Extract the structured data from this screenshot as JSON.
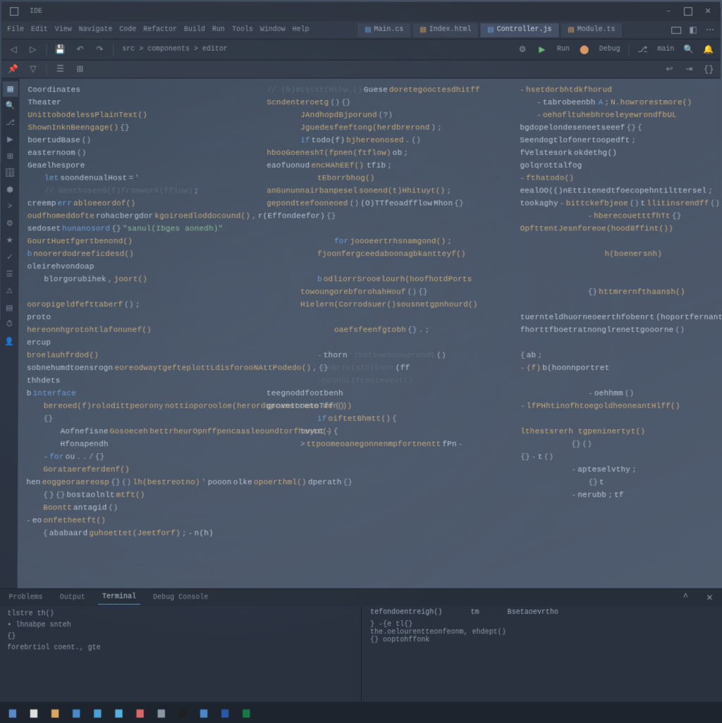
{
  "titlebar": {
    "app_label": "IDE",
    "right_label": "minimize maximize close"
  },
  "tabs": [
    {
      "label": "Main.cs",
      "active": false
    },
    {
      "label": "Index.html",
      "active": false
    },
    {
      "label": "Controller.js",
      "active": true
    },
    {
      "label": "Module.ts",
      "active": false
    }
  ],
  "menu": {
    "items": [
      "File",
      "Edit",
      "View",
      "Navigate",
      "Code",
      "Refactor",
      "Build",
      "Run",
      "Tools",
      "Window",
      "Help"
    ]
  },
  "toolbar": {
    "breadcrumb": "src > components > editor",
    "run_label": "Run",
    "debug_label": "Debug",
    "branch": "main"
  },
  "sidebar": {
    "items": [
      "explorer",
      "search",
      "git",
      "debug",
      "extensions",
      "database",
      "docker",
      "terminal",
      "settings",
      "bookmark",
      "test",
      "outline",
      "problems",
      "output",
      "timeline",
      "account"
    ]
  },
  "code": [
    {
      "i": 0,
      "t": [
        [
          "var",
          "Coordinates"
        ]
      ]
    },
    {
      "i": 0,
      "t": [
        [
          "var",
          "Theater"
        ]
      ]
    },
    {
      "i": 0,
      "t": [
        [
          "fn",
          "UnittobodelessPlainText()"
        ]
      ]
    },
    {
      "i": 0,
      "t": [
        [
          "fn",
          "ShownInknBeengage()"
        ],
        [
          "op",
          "{}"
        ]
      ]
    },
    {
      "i": 0,
      "t": [
        [
          "var",
          "boertudBase"
        ],
        [
          "op",
          "()"
        ]
      ]
    },
    {
      "i": 0,
      "t": [
        [
          "var",
          "easternoom"
        ],
        [
          "op",
          "()"
        ]
      ]
    },
    {
      "i": 0,
      "t": [
        [
          "var",
          "Geaelhespore"
        ]
      ]
    },
    {
      "i": 1,
      "t": [
        [
          "kw",
          "let"
        ],
        [
          "var",
          "soondenualHost"
        ],
        [
          "op",
          "="
        ],
        [
          "str",
          "'"
        ]
      ]
    },
    {
      "i": 1,
      "t": [
        [
          "cmt",
          "// Genthosend(f)framwork(fflow)"
        ],
        [
          "op",
          ";"
        ]
      ]
    },
    {
      "i": 0,
      "t": [
        [
          "var",
          "creemp"
        ],
        [
          "kw",
          "err"
        ],
        [
          "fn",
          "abloeeordof()"
        ]
      ]
    },
    {
      "i": 0,
      "t": [
        [
          "fn",
          "oudfhomeddofte"
        ],
        [
          "var",
          "rohacbergdor"
        ],
        [
          "fn",
          "kgoiroedloddocound()"
        ],
        [
          "op",
          ","
        ],
        [
          "var",
          "r(Effondeefor)"
        ],
        [
          "op",
          "{}"
        ]
      ]
    },
    {
      "i": 0,
      "t": [
        [
          "var",
          "sedoset"
        ],
        [
          "kw",
          "hunanosord"
        ],
        [
          "op",
          "{}"
        ],
        [
          "str",
          "\"sanul(Ibges aonedh)\""
        ]
      ]
    },
    {
      "i": 0,
      "t": [
        [
          "fn",
          "GourtHuetfgertbenond()"
        ]
      ]
    },
    {
      "i": 0,
      "t": [
        [
          "kw",
          "b"
        ],
        [
          "fn",
          "noorerdodreeficdesd()"
        ]
      ]
    },
    {
      "i": 0,
      "t": [
        [
          "var",
          "oleirehvondoap"
        ]
      ]
    },
    {
      "i": 1,
      "t": [
        [
          "var",
          "blorgorubihek"
        ],
        [
          "op",
          ","
        ],
        [
          "fn",
          "joort()"
        ]
      ]
    },
    {
      "i": 0,
      "t": []
    },
    {
      "i": 0,
      "t": [
        [
          "fn",
          "ooropigeldfefttaberf"
        ],
        [
          "op",
          "()"
        ],
        [
          "op",
          ";"
        ]
      ]
    },
    {
      "i": 0,
      "t": [
        [
          "var",
          "proto"
        ]
      ]
    },
    {
      "i": 0,
      "t": [
        [
          "fn",
          "hereonnhgrotohtlafonunef()"
        ]
      ]
    },
    {
      "i": 0,
      "t": [
        [
          "var",
          "ercup"
        ]
      ]
    },
    {
      "i": 0,
      "t": [
        [
          "fn",
          "broelauhfrdod()"
        ]
      ]
    },
    {
      "i": 0,
      "t": [
        [
          "var",
          "sobnehumdtoensrogn"
        ],
        [
          "fn",
          "eoreodwaytgefteplottLdisforooNAttPodedo()"
        ],
        [
          "op",
          ","
        ],
        [
          "op",
          "{}"
        ]
      ]
    },
    {
      "i": 0,
      "t": [
        [
          "var",
          "thhdets"
        ]
      ]
    },
    {
      "i": 0,
      "t": [
        [
          "var",
          "b"
        ],
        [
          "kw",
          "interface"
        ]
      ]
    },
    {
      "i": 1,
      "t": [
        [
          "fn",
          "bereoed(f)rolodittpeorony"
        ],
        [
          "fn",
          "nottioporooloe(herordupcanotrono wer())"
        ]
      ]
    },
    {
      "i": 1,
      "t": [
        [
          "op",
          "{}"
        ]
      ]
    },
    {
      "i": 2,
      "t": [
        [
          "var",
          "Aofnefisne"
        ],
        [
          "fn",
          "Gosoeceh"
        ],
        [
          "fn",
          "bettrheurOpnffpencaasleoundtorfhentt()"
        ],
        [
          "op",
          "{"
        ]
      ]
    },
    {
      "i": 2,
      "t": [
        [
          "var",
          "Hfonapendh"
        ]
      ]
    },
    {
      "i": 1,
      "t": [
        [
          "op",
          "-"
        ],
        [
          "kw",
          "for"
        ],
        [
          "var",
          "ou"
        ],
        [
          "op",
          "."
        ],
        [
          "op",
          "."
        ],
        [
          "op",
          "/"
        ],
        [
          "op",
          "{}"
        ]
      ]
    },
    {
      "i": 1,
      "t": [
        [
          "fn",
          "Gorataereferdenf()"
        ]
      ]
    },
    {
      "i": 0,
      "t": [
        [
          "var",
          "hen"
        ],
        [
          "fn",
          "eoggeoraereosp"
        ],
        [
          "op",
          "{}"
        ],
        [
          "op",
          "()"
        ],
        [
          "fn",
          "lh(bestreotno)"
        ],
        [
          "op",
          "'"
        ],
        [
          "var",
          "pooon"
        ],
        [
          "var",
          "olke"
        ],
        [
          "fn",
          "opoerthml()"
        ],
        [
          "var",
          "dperath"
        ],
        [
          "op",
          "{}"
        ]
      ]
    },
    {
      "i": 1,
      "t": [
        [
          "op",
          "{"
        ],
        [
          "op",
          "}"
        ],
        [
          "op",
          "{}"
        ],
        [
          "var",
          "bostaolnlt"
        ],
        [
          "fn",
          "mtft()"
        ]
      ]
    },
    {
      "i": 1,
      "t": [
        [
          "fn",
          "Boontt"
        ],
        [
          "var",
          "antagid"
        ],
        [
          "op",
          "()"
        ]
      ]
    },
    {
      "i": 0,
      "t": [
        [
          "op",
          "-"
        ],
        [
          "var",
          "eo"
        ],
        [
          "fn",
          "onfetheetft()"
        ]
      ]
    },
    {
      "i": 1,
      "t": [
        [
          "op",
          "{"
        ],
        [
          "var",
          "ababaard"
        ],
        [
          "fn",
          "guhoettet(Jeetforf)"
        ],
        [
          "op",
          ";"
        ],
        [
          "op",
          "-"
        ],
        [
          "var",
          "n(h)"
        ]
      ]
    }
  ],
  "editor_right": [
    {
      "i": 0,
      "t": [
        [
          "cmt",
          "// (b)etstst(Hthw.()"
        ],
        [
          "var",
          "Guese"
        ],
        [
          "fn",
          "doretegooctesdhitff"
        ]
      ]
    },
    {
      "i": 0,
      "t": [
        [
          "fn",
          "Scndenteroetg"
        ],
        [
          "op",
          "()"
        ],
        [
          "op",
          "{}"
        ]
      ]
    },
    {
      "i": 2,
      "t": [
        [
          "fn",
          "JAndhopdBjporund"
        ],
        [
          "op",
          "(?)"
        ]
      ]
    },
    {
      "i": 2,
      "t": [
        [
          "fn",
          "Jguedesfeeftong(herdbrerond"
        ],
        [
          "op",
          ")"
        ],
        [
          "op",
          ";"
        ]
      ]
    },
    {
      "i": 2,
      "t": [
        [
          "kw",
          "if"
        ],
        [
          "var",
          "todo(f)"
        ],
        [
          "fn",
          "bjhereonosed"
        ],
        [
          "op",
          "."
        ],
        [
          "op",
          "()"
        ]
      ]
    },
    {
      "i": 0,
      "t": [
        [
          "fn",
          "hbooGoeneshT(fpnen(ftflow)"
        ],
        [
          "var",
          "ob"
        ],
        [
          "op",
          ";"
        ]
      ]
    },
    {
      "i": 0,
      "t": [
        [
          "var",
          "eaofuonud"
        ],
        [
          "fn",
          "encHAhEEf()"
        ],
        [
          "op",
          ""
        ],
        [
          "var",
          "tfib"
        ],
        [
          "op",
          ";"
        ]
      ]
    },
    {
      "i": 3,
      "t": [
        [
          "fn",
          "tEborrbhog()"
        ]
      ]
    },
    {
      "i": 0,
      "t": [
        [
          "fn",
          "anGununnairbanpesel"
        ],
        [
          "fn",
          "sonend(t)Hhituyt()"
        ],
        [
          "op",
          ";"
        ]
      ]
    },
    {
      "i": 0,
      "t": [
        [
          "fn",
          "gepondteefooneoed"
        ],
        [
          "op",
          "()"
        ],
        [
          "var",
          "(O)TTfeoadfflow"
        ],
        [
          "var",
          "Mhon"
        ],
        [
          "op",
          "{}"
        ]
      ]
    },
    {
      "i": 0,
      "t": []
    },
    {
      "i": 0,
      "t": []
    },
    {
      "i": 4,
      "t": [
        [
          "kw",
          "for"
        ],
        [
          "fn",
          "joooeertrhsnamgond()"
        ],
        [
          "op",
          ";"
        ]
      ]
    },
    {
      "i": 3,
      "t": [
        [
          "fn",
          "fjoonfergceedaboonagbkantteyf()"
        ]
      ]
    },
    {
      "i": 0,
      "t": []
    },
    {
      "i": 3,
      "t": [
        [
          "kw",
          "b"
        ],
        [
          "fn",
          "odliorrSrooelourh(hoofhotdPorts"
        ]
      ]
    },
    {
      "i": 2,
      "t": [
        [
          "fn",
          "towoungorebforohahHouf"
        ],
        [
          "op",
          "()"
        ],
        [
          "op",
          "{}"
        ]
      ]
    },
    {
      "i": 2,
      "t": [
        [
          "fn",
          "Hielern(Corrodsuer()sousnetgpnhourd()"
        ]
      ]
    },
    {
      "i": 0,
      "t": []
    },
    {
      "i": 4,
      "t": [
        [
          "fn",
          "oaefsfeenfgtobh"
        ],
        [
          "op",
          "{}"
        ],
        [
          "op",
          "."
        ],
        [
          "op",
          ";"
        ]
      ]
    },
    {
      "i": 0,
      "t": []
    },
    {
      "i": 3,
      "t": [
        [
          "kw",
          "-"
        ],
        [
          "var",
          "thorn"
        ],
        [
          "cmt",
          "'thatewehouuerendt"
        ],
        [
          "op",
          "()"
        ]
      ]
    },
    {
      "i": 3,
      "t": [
        [
          "cmt",
          "-Fobrtetstb(benh"
        ],
        [
          "var",
          "(ff"
        ]
      ]
    },
    {
      "i": 3,
      "t": [
        [
          "cmt",
          "-bpOnhLifLeGievevt()"
        ]
      ]
    },
    {
      "i": 6,
      "t": [
        [
          "var",
          "teegnoddfootbenh"
        ]
      ]
    },
    {
      "i": 6,
      "t": [
        [
          "var",
          "grovetooetoTff"
        ],
        [
          "op",
          "()"
        ]
      ]
    },
    {
      "i": 3,
      "t": [
        [
          "kw",
          "if"
        ],
        [
          "fn",
          "oiftetBhmtt()"
        ],
        [
          "op",
          "{"
        ]
      ]
    },
    {
      "i": 2,
      "t": [
        [
          "var",
          "tvyot"
        ],
        [
          "op",
          "-"
        ]
      ]
    },
    {
      "i": 2,
      "t": [
        [
          "op",
          ">"
        ],
        [
          "fn",
          "ttpoomeoanegonnenmpfortnentt"
        ],
        [
          "var",
          "fPn"
        ],
        [
          "op",
          "-"
        ]
      ]
    },
    {
      "i": 0,
      "t": []
    }
  ],
  "editor_far_right": [
    {
      "i": 0,
      "t": [
        [
          "op",
          "-"
        ],
        [
          "fn",
          "hsetdorbhtdkfhorud"
        ]
      ]
    },
    {
      "i": 1,
      "t": [
        [
          "op",
          "-"
        ],
        [
          "var",
          "tabrobeenbh"
        ],
        [
          "op",
          ""
        ],
        [
          "kw",
          "A"
        ],
        [
          "op",
          ";"
        ],
        [
          "fn",
          "N.howrorestmore()"
        ]
      ]
    },
    {
      "i": 1,
      "t": [
        [
          "op",
          "-"
        ],
        [
          "fn",
          "oehofltuhebhroeleyewrondfbUL"
        ]
      ]
    },
    {
      "i": 0,
      "t": [
        [
          "var",
          "bgdopelondeseneetseeef"
        ],
        [
          "op",
          "{}"
        ],
        [
          "op",
          "{"
        ]
      ]
    },
    {
      "i": 0,
      "t": [
        [
          "var",
          "Seendogtlofonertoopedft"
        ],
        [
          "op",
          ";"
        ]
      ]
    },
    {
      "i": 0,
      "t": [
        [
          "var",
          "fVelstesork"
        ],
        [
          "var",
          "okdethg()"
        ]
      ]
    },
    {
      "i": 0,
      "t": [
        [
          "var",
          "golqrottalfog"
        ]
      ]
    },
    {
      "i": 0,
      "t": [
        [
          "op",
          "-"
        ],
        [
          "fn",
          "fthatodo()"
        ]
      ]
    },
    {
      "i": 0,
      "t": [
        [
          "var",
          "eealOO(()nEttitenedtfoecopehntilttersel"
        ],
        [
          "op",
          ";"
        ]
      ]
    },
    {
      "i": 0,
      "t": [
        [
          "var",
          "tookaghy"
        ],
        [
          "op",
          "-"
        ],
        [
          "fn",
          "bittckefbjeoe"
        ],
        [
          "op",
          "()"
        ],
        [
          "var",
          "t"
        ],
        [
          "fn",
          "llitinsrendff"
        ],
        [
          "op",
          "()"
        ]
      ]
    },
    {
      "i": 4,
      "t": [
        [
          "op",
          "-"
        ],
        [
          "fn",
          "hberecouetttfhTt"
        ],
        [
          "op",
          "{}"
        ]
      ]
    },
    {
      "i": 0,
      "t": [
        [
          "fn",
          "OpfttentJesnforeoe(hood8ffint())"
        ]
      ]
    },
    {
      "i": 0,
      "t": []
    },
    {
      "i": 5,
      "t": [
        [
          "fn",
          "h(boenersnh)"
        ]
      ]
    },
    {
      "i": 0,
      "t": []
    },
    {
      "i": 0,
      "t": []
    },
    {
      "i": 4,
      "t": [
        [
          "op",
          "{}"
        ],
        [
          "fn",
          "httmrernfthaansh()"
        ]
      ]
    },
    {
      "i": 0,
      "t": []
    },
    {
      "i": 0,
      "t": [
        [
          "var",
          "tuernteldhuorneoeerthfobenrt"
        ],
        [
          "var",
          "(hoportfernantt"
        ]
      ]
    },
    {
      "i": 0,
      "t": [
        [
          "var",
          "fhorttfboetratnonglrenettgooorne"
        ],
        [
          "op",
          "()"
        ]
      ]
    },
    {
      "i": 0,
      "t": []
    },
    {
      "i": 0,
      "t": [
        [
          "op",
          "{"
        ],
        [
          "var",
          "ab"
        ],
        [
          "op",
          ";"
        ]
      ]
    },
    {
      "i": 0,
      "t": [
        [
          "op",
          "-"
        ],
        [
          "fn",
          "(f)"
        ],
        [
          "var",
          "b(hoonnportret"
        ]
      ]
    },
    {
      "i": 0,
      "t": []
    },
    {
      "i": 4,
      "t": [
        [
          "op",
          "-"
        ],
        [
          "var",
          "oehhmm"
        ],
        [
          "op",
          "()"
        ]
      ]
    },
    {
      "i": 0,
      "t": [
        [
          "op",
          "-"
        ],
        [
          "fn",
          "lfPHhtinofhtoegoldheoneantHlff()"
        ]
      ]
    },
    {
      "i": 0,
      "t": []
    },
    {
      "i": 0,
      "t": [
        [
          "fn",
          "lthestsrerh tgpeninertyt()"
        ]
      ]
    },
    {
      "i": 3,
      "t": [
        [
          "op",
          "{}"
        ],
        [
          "op",
          "()"
        ]
      ]
    },
    {
      "i": 0,
      "t": [
        [
          "op",
          "{}"
        ],
        [
          "op",
          "-"
        ],
        [
          "var",
          "t"
        ],
        [
          "op",
          "()"
        ]
      ]
    },
    {
      "i": 3,
      "t": [
        [
          "op",
          "-"
        ],
        [
          "var",
          "apteselvthy"
        ],
        [
          "op",
          ";"
        ]
      ]
    },
    {
      "i": 4,
      "t": [
        [
          "op",
          "{}"
        ],
        [
          "var",
          "t"
        ]
      ]
    },
    {
      "i": 3,
      "t": [
        [
          "op",
          "-"
        ],
        [
          "var",
          "nerubb"
        ],
        [
          "op",
          ";"
        ],
        [
          "var",
          "tf"
        ]
      ]
    }
  ],
  "panel": {
    "tabs": [
      "Problems",
      "Output",
      "Terminal",
      "Debug Console"
    ],
    "active_tab": 2,
    "left_lines": [
      "tlstre  th()",
      "• lhnabpe   snteh",
      "  {}",
      "forebrtiol coent., gte"
    ],
    "right_header_left": "tefondoentreigh()",
    "right_header_mid": "tm",
    "right_header_right": "Bsetaoevrtho",
    "right_lines": [
      "}  -{e  tl{}",
      "the.oelourentteonfeonm,   ehdept()",
      "{}  ooptohffonk"
    ]
  },
  "taskbar": {
    "items": [
      "start",
      "search",
      "files",
      "edge",
      "store",
      "mail",
      "photos",
      "settings",
      "terminal",
      "code",
      "word",
      "excel"
    ]
  },
  "colors": {
    "accent": "#5a8ac8",
    "keyword": "#6a9dd8",
    "function": "#c8a878",
    "string": "#8ab890"
  }
}
